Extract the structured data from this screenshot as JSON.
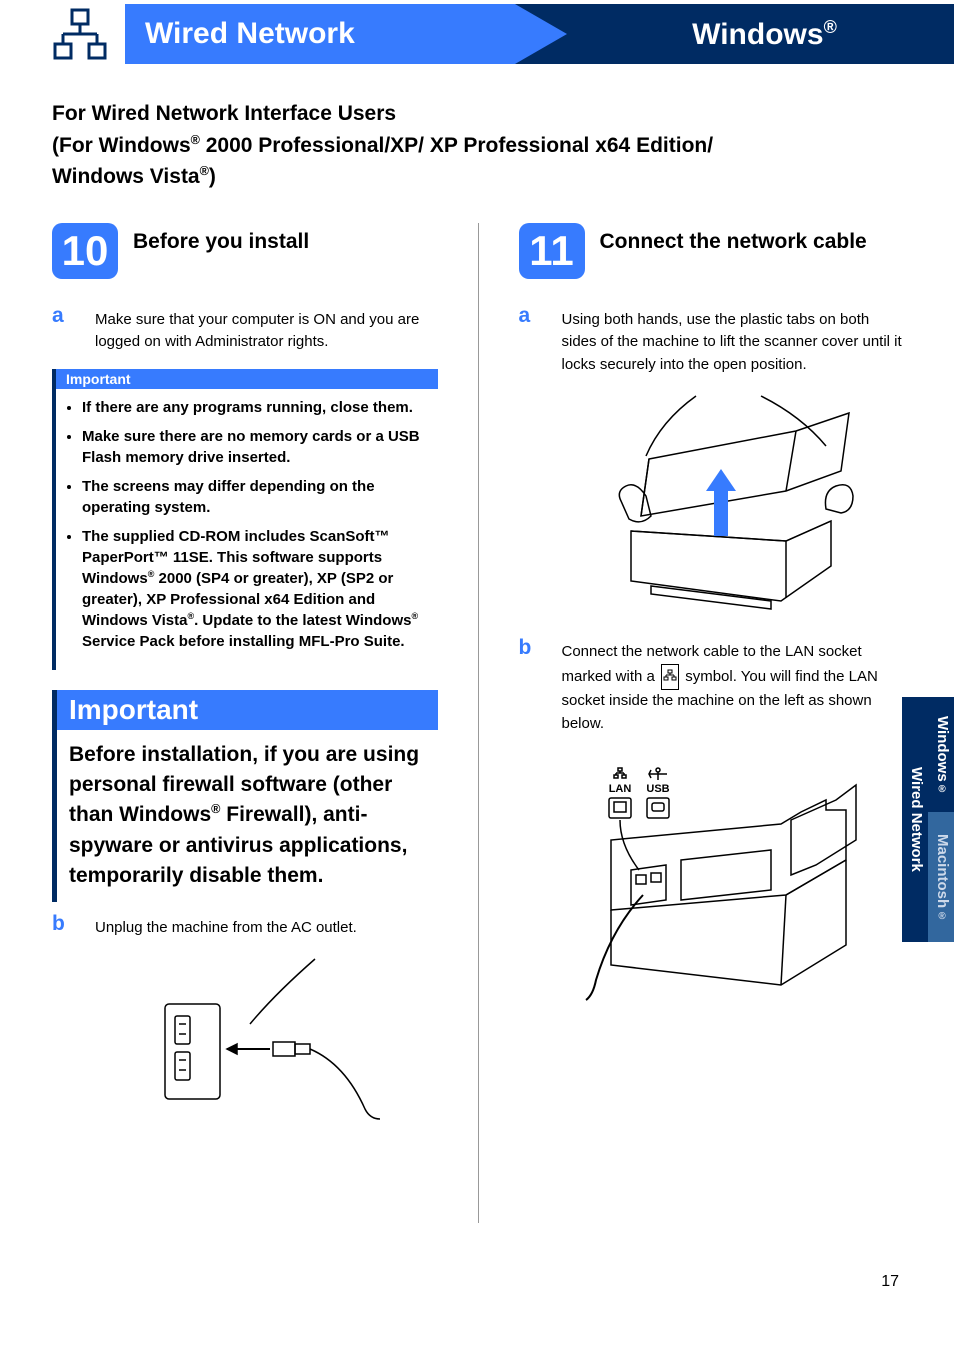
{
  "header": {
    "left": "Wired Network",
    "right": "Windows"
  },
  "intro": {
    "line1": "For Wired Network Interface Users",
    "line2a": "(For Windows",
    "line2b": " 2000 Professional/XP/ XP Professional x64 Edition/",
    "line3a": "Windows Vista",
    "line3b": ")"
  },
  "step10": {
    "number": "10",
    "title": "Before you install",
    "sub_a": "Make sure that your computer is ON and you are logged on with Administrator rights.",
    "important_label": "Important",
    "bullets": {
      "b1": "If there are any programs running, close them.",
      "b2": "Make sure there are no memory cards or a USB Flash memory drive inserted.",
      "b3": "The screens may differ depending on the operating system.",
      "b4a": "The supplied CD-ROM includes ScanSoft™ PaperPort™ 11SE. This software supports Windows",
      "b4b": " 2000 (SP4 or greater), XP (SP2 or greater), XP Professional x64 Edition and Windows Vista",
      "b4c": ". Update to the latest Windows",
      "b4d": " Service Pack before installing MFL-Pro Suite."
    },
    "big_important_label": "Important",
    "big_important_body_a": "Before installation, if you are using personal firewall software (other than Windows",
    "big_important_body_b": " Firewall), anti-spyware or antivirus applications, temporarily disable them.",
    "sub_b": "Unplug the machine from the AC outlet."
  },
  "step11": {
    "number": "11",
    "title": "Connect the network cable",
    "sub_a": "Using both hands, use the plastic tabs on both sides of the machine to lift the scanner cover until it locks securely into the open position.",
    "sub_b_1": "Connect the network cable to the LAN socket marked with a ",
    "sub_b_2": " symbol. You will find the LAN socket inside the machine on the left as shown below.",
    "labels": {
      "lan": "LAN",
      "usb": "USB"
    }
  },
  "tabs": {
    "windows": "Windows",
    "macintosh": "Macintosh",
    "wired": "Wired Network"
  },
  "page_number": "17"
}
